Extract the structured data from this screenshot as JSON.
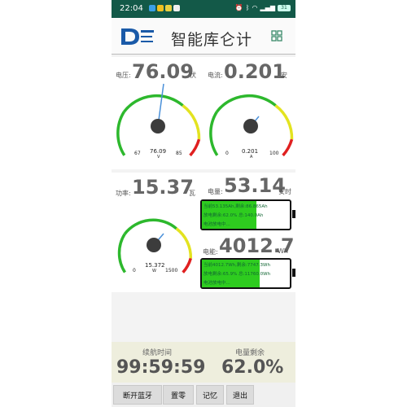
{
  "status_bar": {
    "time": "22:04",
    "battery": "31"
  },
  "header": {
    "title": "智能库仑计"
  },
  "voltage": {
    "label": "电压:",
    "value": "76.09",
    "unit": "伏",
    "gauge_value": "76.09",
    "gauge_unit": "V",
    "min": "67",
    "max": "85"
  },
  "current": {
    "label": "电流:",
    "value": "0.201",
    "unit": "安",
    "gauge_value": "0.201",
    "gauge_unit": "A",
    "min": "0",
    "max": "100"
  },
  "power": {
    "label": "功率:",
    "value": "15.37",
    "unit": "瓦",
    "gauge_value": "15.372",
    "gauge_unit": "W",
    "min": "0",
    "max": "1500"
  },
  "charge": {
    "label": "电量:",
    "value": "53.14",
    "unit": "安时",
    "battery": {
      "line1": "当前53.135Ah,剩余:86.865Ah",
      "line2": "放电剩余:62.0%  总:140.0Ah",
      "line3": "电池放电中...",
      "fill_fraction": 0.62
    }
  },
  "energy": {
    "label": "电能:",
    "value": "4012.7",
    "unit": "Wh",
    "battery": {
      "line1": "当前4012.7Wh,剩余:7747.3Wh",
      "line2": "放电剩余:65.9%  总:11760.0Wh",
      "line3": "电池放电中...",
      "fill_fraction": 0.659
    }
  },
  "footer": {
    "runtime_label": "续航时间",
    "runtime_value": "99:59:59",
    "remaining_label": "电量剩余",
    "remaining_value": "62.0%"
  },
  "buttons": {
    "disconnect": "断开蓝牙",
    "reset": "置零",
    "memory": "记忆",
    "exit": "退出"
  }
}
